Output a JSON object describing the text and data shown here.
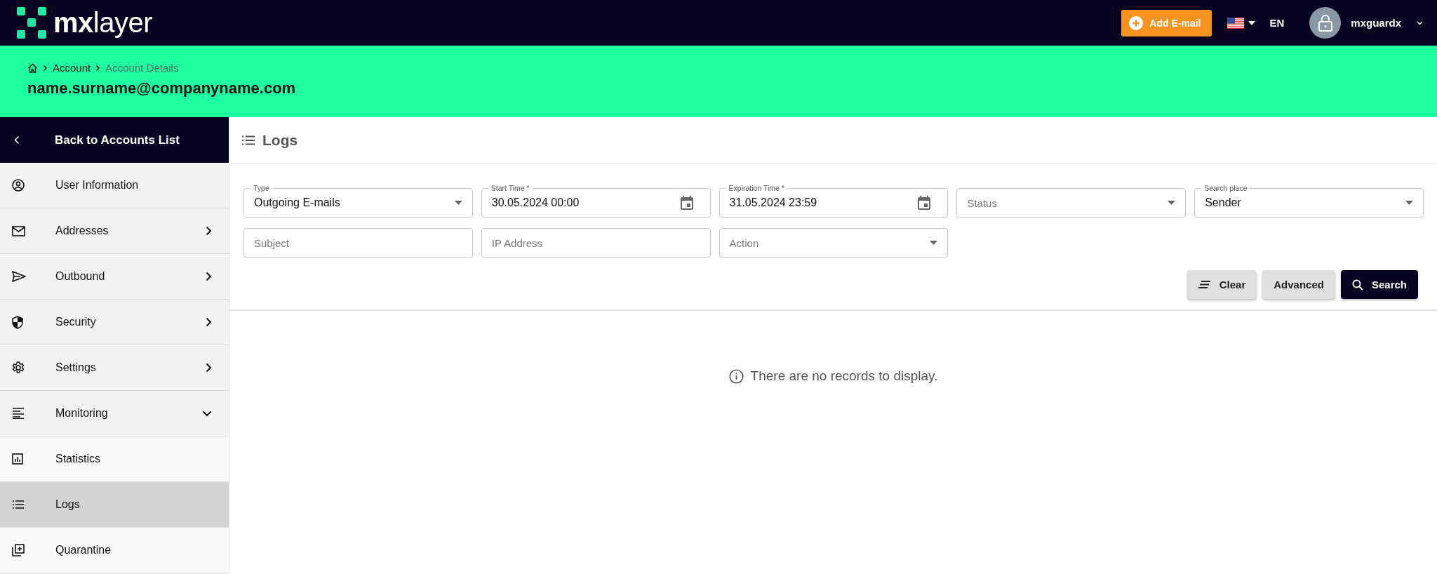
{
  "topbar": {
    "logo": "**mx**layer",
    "add_button": "Add E-mail",
    "language": "EN",
    "user": "mxguardx"
  },
  "breadcrumb": [
    {
      "label": "Account",
      "current": false
    },
    {
      "label": "Account Details",
      "current": true
    }
  ],
  "account_email": "name.surname@companyname.com",
  "sidebar": {
    "back": "Back to Accounts List",
    "items": [
      {
        "label": "User Information",
        "kind": "link",
        "selected": false
      },
      {
        "label": "Addresses",
        "kind": "group",
        "expanded": false,
        "selected": false
      },
      {
        "label": "Outbound",
        "kind": "group",
        "expanded": false,
        "selected": false
      },
      {
        "label": "Security",
        "kind": "group",
        "expanded": false,
        "selected": false
      },
      {
        "label": "Settings",
        "kind": "group",
        "expanded": false,
        "selected": false
      },
      {
        "label": "Monitoring",
        "kind": "group",
        "expanded": true,
        "selected": false,
        "children": [
          {
            "label": "Statistics",
            "selected": false
          },
          {
            "label": "Logs",
            "selected": true
          },
          {
            "label": "Quarantine",
            "selected": false
          }
        ]
      }
    ]
  },
  "panel": {
    "title": "Logs",
    "fields": [
      {
        "kind": "select",
        "label": "Type",
        "value": "Outgoing E-mails"
      },
      {
        "kind": "date",
        "label": "Start Time *",
        "value": "30.05.2024 00:00"
      },
      {
        "kind": "date",
        "label": "Expiration Time *",
        "value": "31.05.2024 23:59"
      },
      {
        "kind": "select",
        "placeholder": "Status"
      },
      {
        "kind": "select",
        "label": "Search place",
        "value": "Sender"
      },
      {
        "kind": "text",
        "placeholder": "Subject"
      },
      {
        "kind": "text",
        "placeholder": "IP Address"
      },
      {
        "kind": "select",
        "placeholder": "Action"
      }
    ],
    "buttons": [
      {
        "label": "Clear",
        "kind": "clear"
      },
      {
        "label": "Advanced",
        "kind": "plain"
      },
      {
        "label": "Search",
        "kind": "search"
      }
    ],
    "empty_message": "There are no records to display."
  }
}
